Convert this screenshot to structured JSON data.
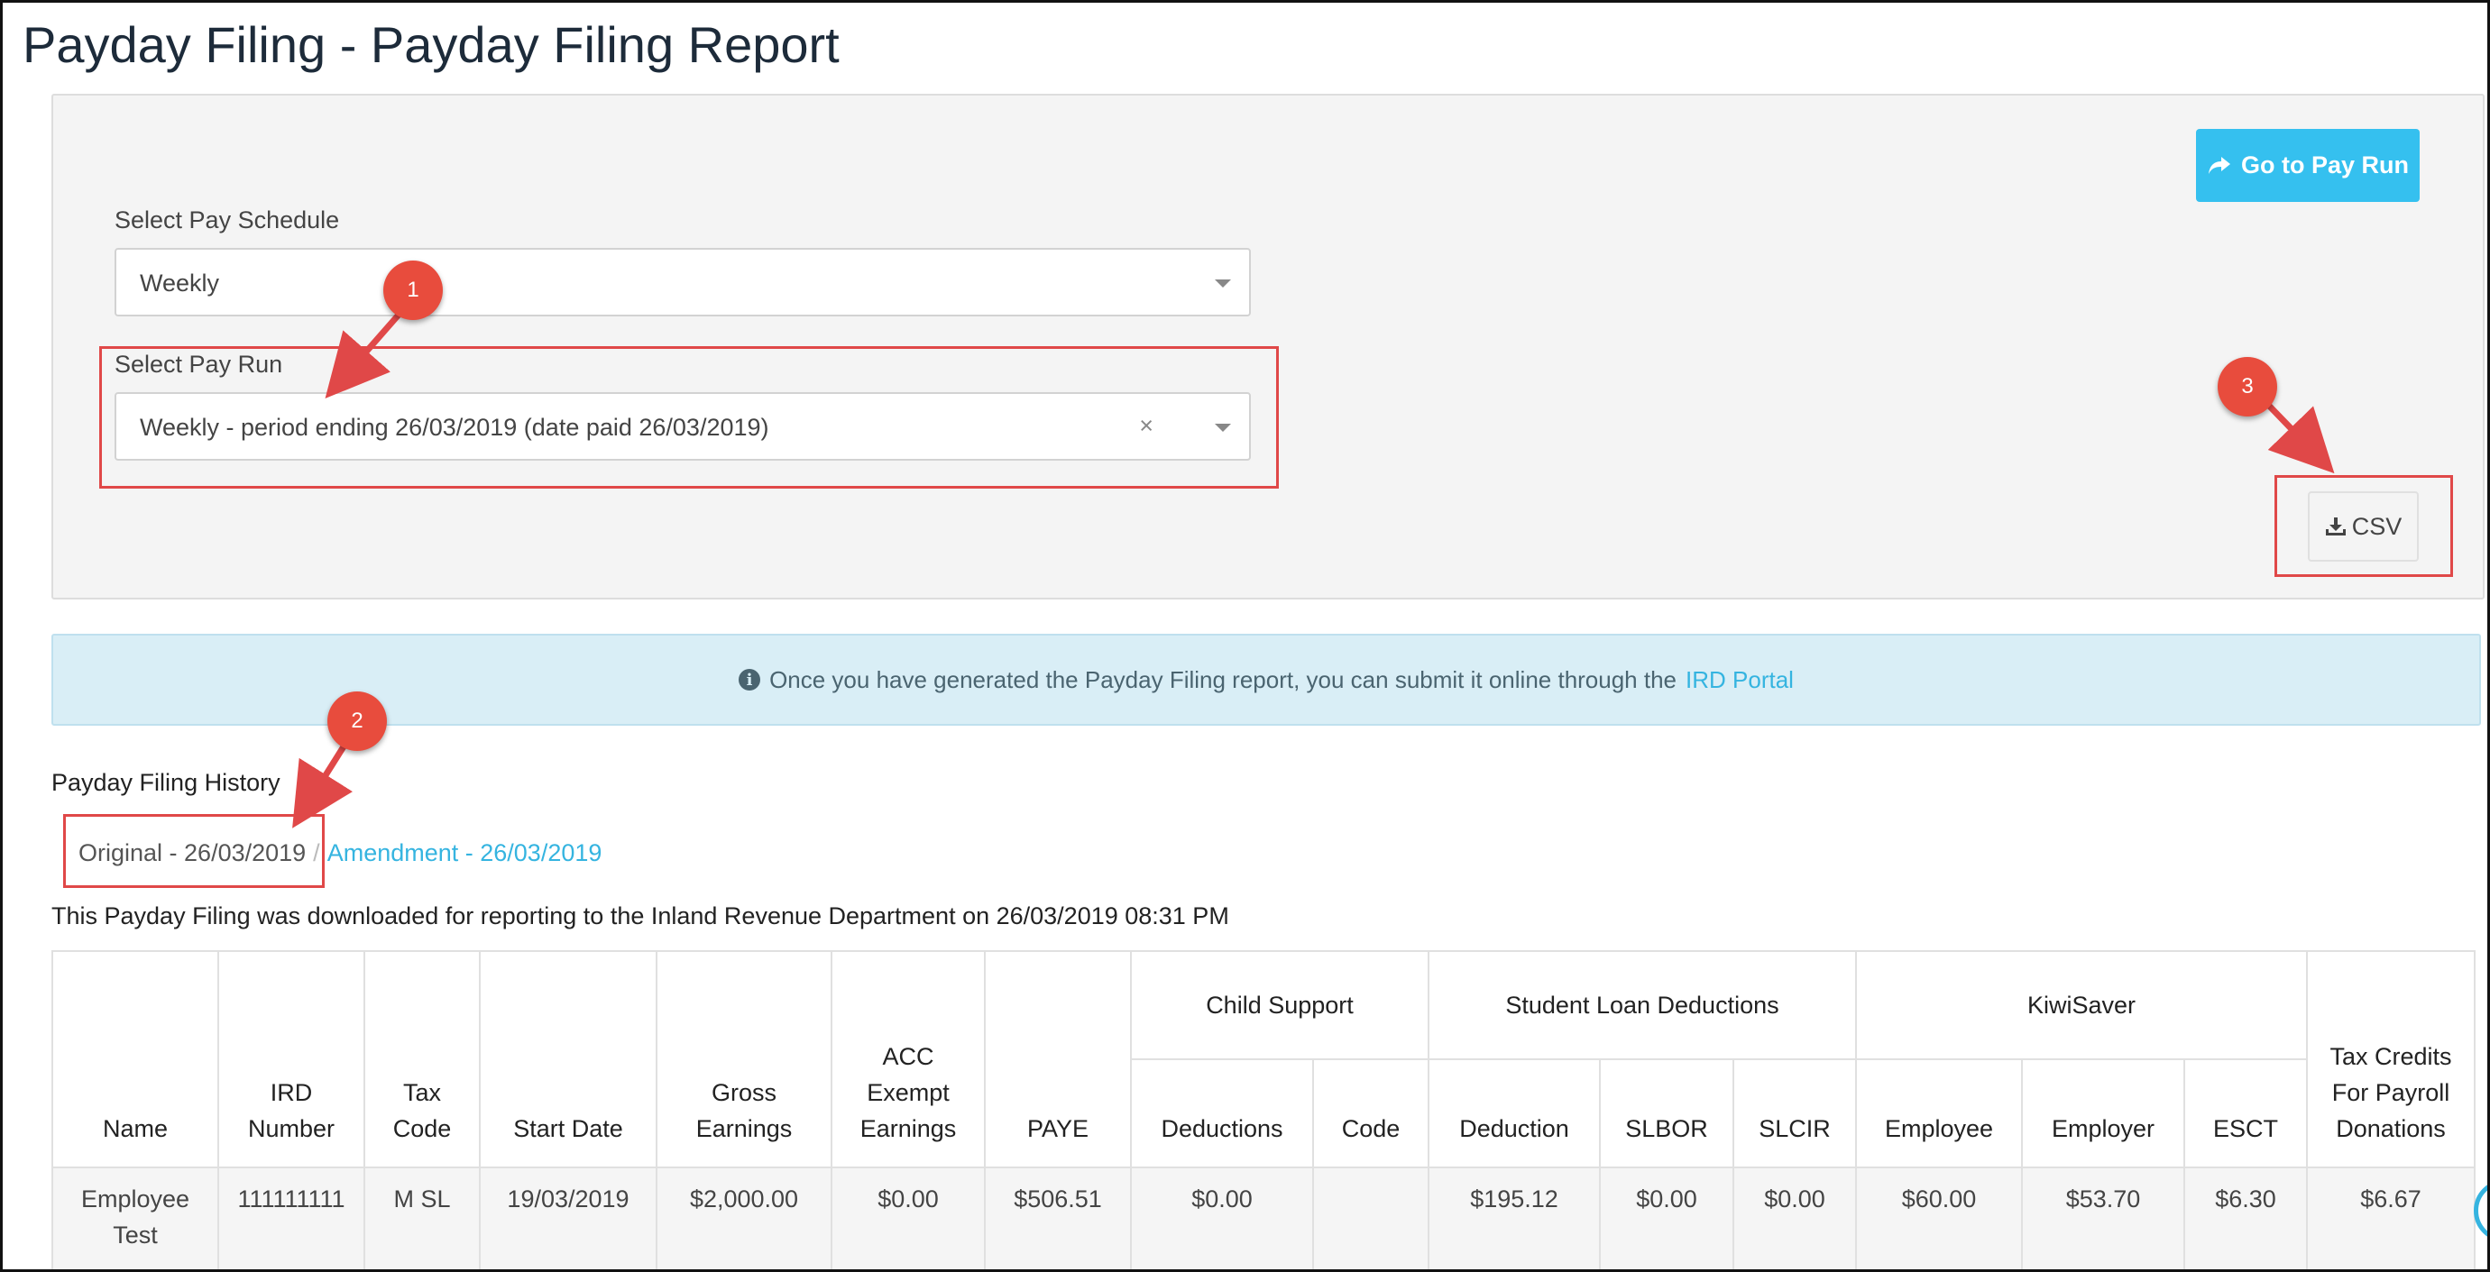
{
  "page": {
    "title": "Payday Filing - Payday Filing Report"
  },
  "toolbar": {
    "go_to_pay_run": "Go to Pay Run",
    "csv": "CSV"
  },
  "form": {
    "pay_schedule": {
      "label": "Select Pay Schedule",
      "value": "Weekly"
    },
    "pay_run": {
      "label": "Select Pay Run",
      "value": "Weekly - period ending 26/03/2019 (date paid 26/03/2019)",
      "clear": "×"
    }
  },
  "annotations": {
    "callout_1": "1",
    "callout_2": "2",
    "callout_3": "3"
  },
  "alert": {
    "text": "Once you have generated the Payday Filing report, you can submit it online through the",
    "link": "IRD Portal"
  },
  "history": {
    "title": "Payday Filing History",
    "original": "Original - 26/03/2019",
    "separator": "/",
    "amendment": "Amendment - 26/03/2019",
    "downloaded_note": "This Payday Filing was downloaded for reporting to the Inland Revenue Department on 26/03/2019 08:31 PM"
  },
  "table": {
    "headers": {
      "name": "Name",
      "ird_number": "IRD Number",
      "tax_code": "Tax Code",
      "start_date": "Start Date",
      "gross_earnings": "Gross Earnings",
      "acc_exempt": "ACC Exempt Earnings",
      "paye": "PAYE",
      "child_support": "Child Support",
      "cs_deductions": "Deductions",
      "cs_code": "Code",
      "student_loan": "Student Loan Deductions",
      "sl_deduction": "Deduction",
      "slbor": "SLBOR",
      "slcir": "SLCIR",
      "kiwisaver": "KiwiSaver",
      "ks_employee": "Employee",
      "ks_employer": "Employer",
      "esct": "ESCT",
      "tax_credits": "Tax Credits For Payroll Donations"
    },
    "rows": [
      {
        "name": "Employee Test",
        "ird_number": "111111111",
        "tax_code": "M SL",
        "start_date": "19/03/2019",
        "gross_earnings": "$2,000.00",
        "acc_exempt": "$0.00",
        "paye": "$506.51",
        "cs_deductions": "$0.00",
        "cs_code": "",
        "sl_deduction": "$195.12",
        "slbor": "$0.00",
        "slcir": "$0.00",
        "ks_employee": "$60.00",
        "ks_employer": "$53.70",
        "esct": "$6.30",
        "tax_credits": "$6.67"
      }
    ]
  }
}
